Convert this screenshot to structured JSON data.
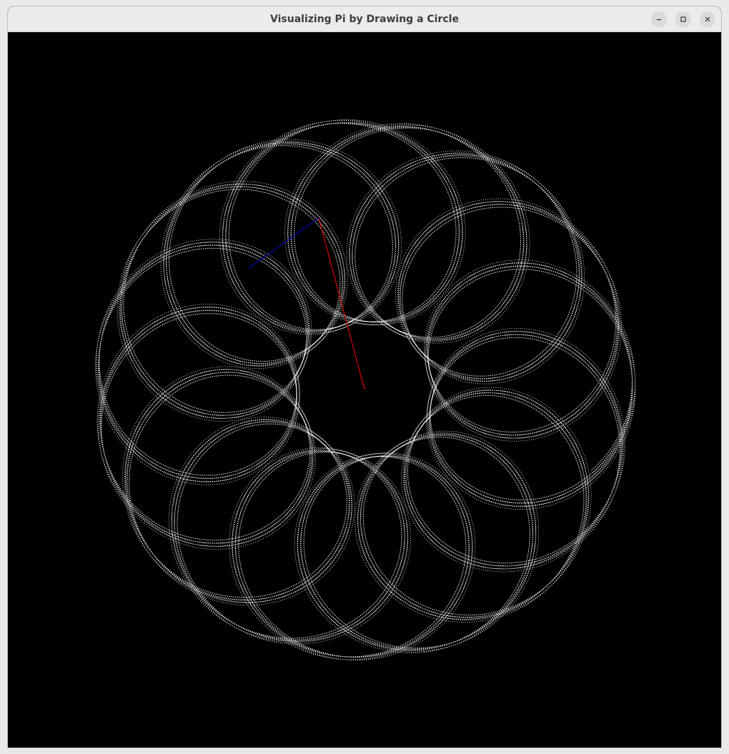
{
  "window": {
    "title": "Visualizing Pi by Drawing a Circle"
  },
  "controls": {
    "minimize": "minimize-icon",
    "maximize": "maximize-icon",
    "close": "close-icon"
  },
  "colors": {
    "background": "#000000",
    "trace": "#ffffff",
    "outer_arm": "#0000b8",
    "inner_arm": "#d80000"
  }
}
